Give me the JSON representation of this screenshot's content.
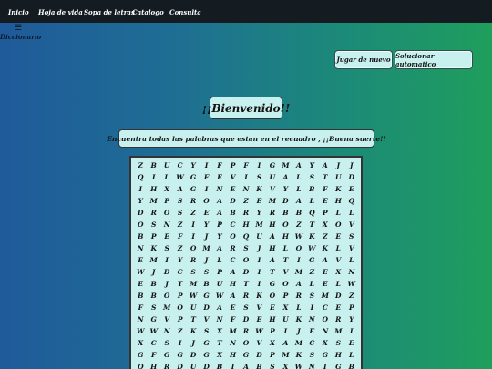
{
  "nav": {
    "items": [
      {
        "label": "Inicio"
      },
      {
        "label": "Hoja de vida"
      },
      {
        "label": "Sopa de letras"
      },
      {
        "label": "Catalogo"
      },
      {
        "label": "Consulta"
      }
    ]
  },
  "sidebar": {
    "icon": "menu-icon",
    "icon_glyph": "☰",
    "label": "Diccionario"
  },
  "actions": {
    "replay_label": "Jugar de nuevo",
    "solve_label": "Solucionar automatico"
  },
  "header": {
    "title": "¡¡Bienvenido!!",
    "subtitle": "Encuentra todas las palabras que estan en el recuadro , ¡¡Buena suerte!!"
  },
  "grid": {
    "rows": [
      [
        "Z",
        "B",
        "U",
        "C",
        "Y",
        "I",
        "F",
        "P",
        "F",
        "I",
        "G",
        "M",
        "A",
        "Y",
        "A",
        "J",
        "J",
        "T",
        "C",
        "P"
      ],
      [
        "Q",
        "I",
        "L",
        "W",
        "G",
        "F",
        "E",
        "V",
        "I",
        "S",
        "U",
        "A",
        "L",
        "S",
        "T",
        "U",
        "D",
        "I",
        "O"
      ],
      [
        "I",
        "H",
        "X",
        "A",
        "G",
        "I",
        "N",
        "E",
        "N",
        "K",
        "V",
        "Y",
        "L",
        "B",
        "F",
        "K",
        "E",
        "A",
        "W"
      ],
      [
        "Y",
        "M",
        "P",
        "S",
        "R",
        "O",
        "A",
        "D",
        "Z",
        "E",
        "M",
        "D",
        "A",
        "L",
        "E",
        "H",
        "Q",
        "R",
        "C",
        "P"
      ],
      [
        "D",
        "R",
        "O",
        "S",
        "Z",
        "E",
        "A",
        "B",
        "R",
        "Y",
        "R",
        "B",
        "B",
        "Q",
        "P",
        "L",
        "L",
        "W",
        "N",
        "P"
      ],
      [
        "O",
        "S",
        "N",
        "Z",
        "I",
        "Y",
        "P",
        "C",
        "H",
        "M",
        "H",
        "O",
        "Z",
        "T",
        "X",
        "O",
        "V",
        "H",
        "W",
        "A"
      ],
      [
        "B",
        "P",
        "E",
        "F",
        "I",
        "J",
        "Y",
        "O",
        "Q",
        "U",
        "A",
        "H",
        "W",
        "K",
        "Z",
        "E",
        "S",
        "I",
        "C",
        "A"
      ],
      [
        "N",
        "K",
        "S",
        "Z",
        "O",
        "M",
        "A",
        "R",
        "S",
        "J",
        "H",
        "L",
        "O",
        "W",
        "K",
        "L",
        "V",
        "Y",
        "D",
        "E"
      ],
      [
        "E",
        "M",
        "I",
        "Y",
        "R",
        "J",
        "L",
        "C",
        "O",
        "I",
        "A",
        "T",
        "I",
        "G",
        "A",
        "V",
        "L",
        "J",
        "D"
      ],
      [
        "W",
        "J",
        "D",
        "C",
        "S",
        "S",
        "P",
        "A",
        "D",
        "I",
        "T",
        "V",
        "M",
        "Z",
        "E",
        "X",
        "N",
        "A",
        "Y"
      ],
      [
        "E",
        "B",
        "J",
        "T",
        "M",
        "B",
        "U",
        "H",
        "T",
        "I",
        "G",
        "O",
        "A",
        "L",
        "E",
        "L",
        "W",
        "Q",
        "S",
        "F"
      ],
      [
        "B",
        "B",
        "O",
        "P",
        "W",
        "G",
        "W",
        "A",
        "R",
        "K",
        "O",
        "P",
        "R",
        "S",
        "M",
        "D",
        "Z",
        "T",
        "V",
        "H"
      ],
      [
        "F",
        "S",
        "M",
        "O",
        "U",
        "D",
        "A",
        "E",
        "S",
        "V",
        "E",
        "X",
        "L",
        "I",
        "C",
        "E",
        "P",
        "Q",
        "I",
        "W"
      ],
      [
        "N",
        "G",
        "V",
        "P",
        "T",
        "V",
        "N",
        "F",
        "D",
        "E",
        "H",
        "U",
        "K",
        "N",
        "O",
        "R",
        "Y",
        "Y",
        "V",
        "Q"
      ],
      [
        "W",
        "W",
        "N",
        "Z",
        "K",
        "S",
        "X",
        "M",
        "R",
        "W",
        "P",
        "I",
        "J",
        "E",
        "N",
        "M",
        "I",
        "E",
        "I",
        "A"
      ],
      [
        "X",
        "C",
        "S",
        "I",
        "J",
        "G",
        "T",
        "N",
        "O",
        "V",
        "X",
        "A",
        "M",
        "C",
        "X",
        "S",
        "E",
        "P",
        "G",
        "D"
      ],
      [
        "G",
        "F",
        "G",
        "G",
        "D",
        "G",
        "X",
        "H",
        "G",
        "D",
        "P",
        "M",
        "K",
        "S",
        "G",
        "H",
        "L",
        "G",
        "T",
        "C"
      ],
      [
        "Q",
        "H",
        "R",
        "D",
        "U",
        "D",
        "B",
        "I",
        "A",
        "B",
        "S",
        "X",
        "W",
        "N",
        "I",
        "G",
        "B",
        "A",
        "M",
        "W"
      ]
    ]
  }
}
